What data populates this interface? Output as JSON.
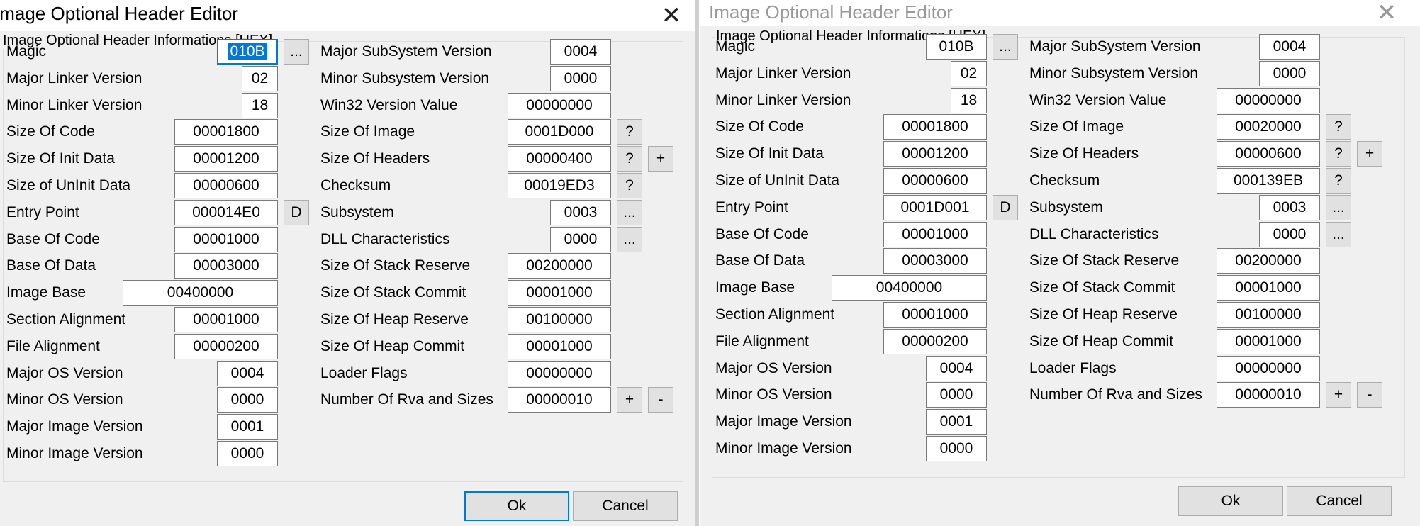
{
  "dialogs": [
    {
      "title": "Image Optional Header Editor",
      "title_active": true,
      "group_label": "Image Optional Header Informations [HEX]",
      "left_fields": [
        {
          "label": "Magic",
          "value": "010B",
          "selected": true
        },
        {
          "label": "Major Linker Version",
          "value": "02"
        },
        {
          "label": "Minor Linker Version",
          "value": "18"
        },
        {
          "label": "Size Of Code",
          "value": "00001800"
        },
        {
          "label": "Size Of Init Data",
          "value": "00001200"
        },
        {
          "label": "Size of UnInit Data",
          "value": "00000600"
        },
        {
          "label": "Entry Point",
          "value": "000014E0"
        },
        {
          "label": "Base Of Code",
          "value": "00001000"
        },
        {
          "label": "Base Of Data",
          "value": "00003000"
        },
        {
          "label": "Image Base",
          "value": "00400000"
        },
        {
          "label": "Section Alignment",
          "value": "00001000"
        },
        {
          "label": "File Alignment",
          "value": "00000200"
        },
        {
          "label": "Major OS Version",
          "value": "0004"
        },
        {
          "label": "Minor OS Version",
          "value": "0000"
        },
        {
          "label": "Major Image Version",
          "value": "0001"
        },
        {
          "label": "Minor Image Version",
          "value": "0000"
        }
      ],
      "right_fields": [
        {
          "label": "Major SubSystem Version",
          "value": "0004"
        },
        {
          "label": "Minor Subsystem Version",
          "value": "0000"
        },
        {
          "label": "Win32 Version Value",
          "value": "00000000"
        },
        {
          "label": "Size Of Image",
          "value": "0001D000"
        },
        {
          "label": "Size Of Headers",
          "value": "00000400"
        },
        {
          "label": "Checksum",
          "value": "00019ED3"
        },
        {
          "label": "Subsystem",
          "value": "0003"
        },
        {
          "label": "DLL Characteristics",
          "value": "0000"
        },
        {
          "label": "Size Of Stack Reserve",
          "value": "00200000"
        },
        {
          "label": "Size Of Stack Commit",
          "value": "00001000"
        },
        {
          "label": "Size Of Heap Reserve",
          "value": "00100000"
        },
        {
          "label": "Size Of Heap Commit",
          "value": "00001000"
        },
        {
          "label": "Loader Flags",
          "value": "00000000"
        },
        {
          "label": "Number Of Rva and Sizes",
          "value": "00000010"
        }
      ],
      "ok_label": "Ok",
      "cancel_label": "Cancel"
    },
    {
      "title": "Image Optional Header Editor",
      "title_active": false,
      "group_label": "Image Optional Header Informations [HEX]",
      "left_fields": [
        {
          "label": "Magic",
          "value": "010B"
        },
        {
          "label": "Major Linker Version",
          "value": "02"
        },
        {
          "label": "Minor Linker Version",
          "value": "18"
        },
        {
          "label": "Size Of Code",
          "value": "00001800"
        },
        {
          "label": "Size Of Init Data",
          "value": "00001200"
        },
        {
          "label": "Size of UnInit Data",
          "value": "00000600"
        },
        {
          "label": "Entry Point",
          "value": "0001D001"
        },
        {
          "label": "Base Of Code",
          "value": "00001000"
        },
        {
          "label": "Base Of Data",
          "value": "00003000"
        },
        {
          "label": "Image Base",
          "value": "00400000"
        },
        {
          "label": "Section Alignment",
          "value": "00001000"
        },
        {
          "label": "File Alignment",
          "value": "00000200"
        },
        {
          "label": "Major OS Version",
          "value": "0004"
        },
        {
          "label": "Minor OS Version",
          "value": "0000"
        },
        {
          "label": "Major Image Version",
          "value": "0001"
        },
        {
          "label": "Minor Image Version",
          "value": "0000"
        }
      ],
      "right_fields": [
        {
          "label": "Major SubSystem Version",
          "value": "0004"
        },
        {
          "label": "Minor Subsystem Version",
          "value": "0000"
        },
        {
          "label": "Win32 Version Value",
          "value": "00000000"
        },
        {
          "label": "Size Of Image",
          "value": "00020000"
        },
        {
          "label": "Size Of Headers",
          "value": "00000600"
        },
        {
          "label": "Checksum",
          "value": "000139EB"
        },
        {
          "label": "Subsystem",
          "value": "0003"
        },
        {
          "label": "DLL Characteristics",
          "value": "0000"
        },
        {
          "label": "Size Of Stack Reserve",
          "value": "00200000"
        },
        {
          "label": "Size Of Stack Commit",
          "value": "00001000"
        },
        {
          "label": "Size Of Heap Reserve",
          "value": "00100000"
        },
        {
          "label": "Size Of Heap Commit",
          "value": "00001000"
        },
        {
          "label": "Loader Flags",
          "value": "00000000"
        },
        {
          "label": "Number Of Rva and Sizes",
          "value": "00000010"
        }
      ],
      "ok_label": "Ok",
      "cancel_label": "Cancel"
    }
  ],
  "buttons": {
    "ellipsis": "...",
    "question": "?",
    "plus": "+",
    "minus": "-",
    "d": "D"
  },
  "icons": {
    "close": "close-icon"
  },
  "colors": {
    "selection": "#0078d7",
    "dialog_bg": "#f0f0f0",
    "inactive_title": "#999999"
  }
}
